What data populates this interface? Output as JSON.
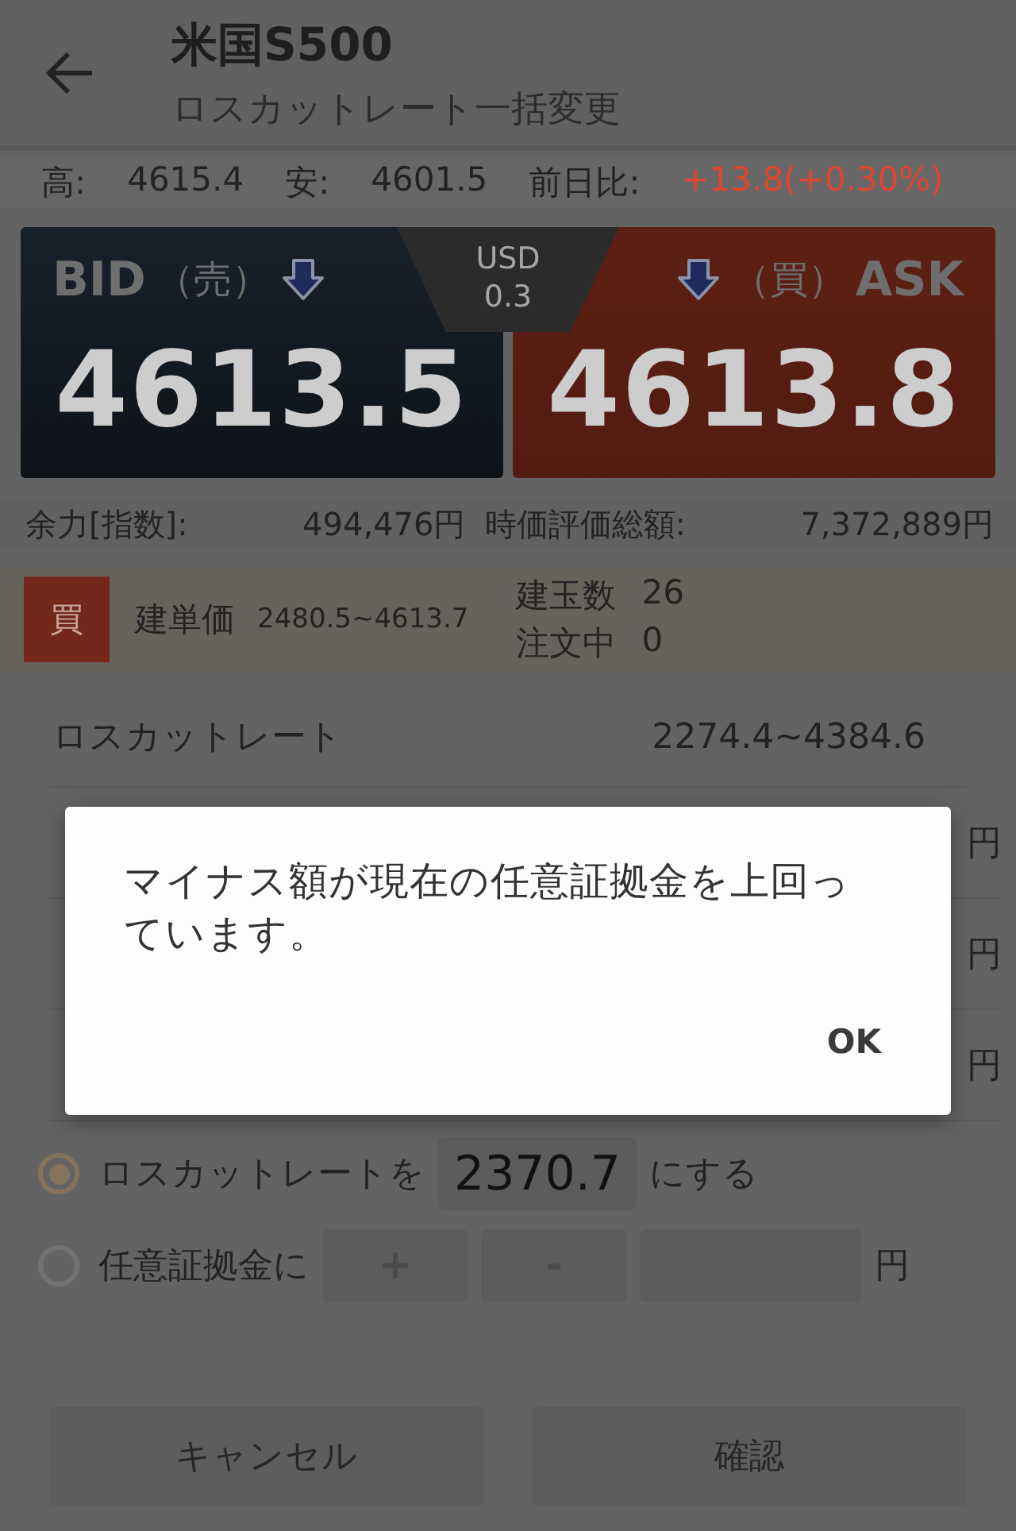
{
  "header": {
    "title": "米国S500",
    "subtitle": "ロスカットレート一括変更"
  },
  "stats": [
    {
      "kind": "plain",
      "label": "高:",
      "value": "4615.4"
    },
    {
      "kind": "plain",
      "label": "安:",
      "value": "4601.5"
    },
    {
      "kind": "change",
      "label": "前日比:",
      "value": "+13.8(+0.30%)"
    }
  ],
  "quotes": {
    "bid": {
      "label": "BID",
      "side": "（売）",
      "price": "4613.5"
    },
    "spread": {
      "currency": "USD",
      "value": "0.3"
    },
    "ask": {
      "label": "ASK",
      "side": "（買）",
      "price": "4613.8"
    }
  },
  "balance": [
    {
      "label": "余力[指数]:",
      "value": "494,476円"
    },
    {
      "label": "時価評価総額:",
      "value": "7,372,889円"
    }
  ],
  "position": {
    "side": "買",
    "price_label": "建単価",
    "price_range": "2480.5~4613.7",
    "stats": [
      {
        "label": "建玉数",
        "value": "26"
      },
      {
        "label": "注文中",
        "value": "0"
      }
    ]
  },
  "losscut": {
    "label": "ロスカットレート",
    "value": "2274.4~4384.6"
  },
  "hidden_rows": [
    {
      "unit": "円"
    },
    {
      "unit": "円"
    },
    {
      "unit": "円"
    }
  ],
  "options": [
    {
      "kind": "rate",
      "selected": true,
      "label": "ロスカットレートを",
      "value": "2370.7",
      "suffix": "にする"
    },
    {
      "kind": "margin",
      "selected": false,
      "label": "任意証拠金に",
      "plus": "+",
      "minus": "-",
      "unit": "円"
    }
  ],
  "buttons": [
    "キャンセル",
    "確認"
  ],
  "dialog": {
    "message": "マイナス額が現在の任意証拠金を上回っています。",
    "ok": "OK"
  }
}
